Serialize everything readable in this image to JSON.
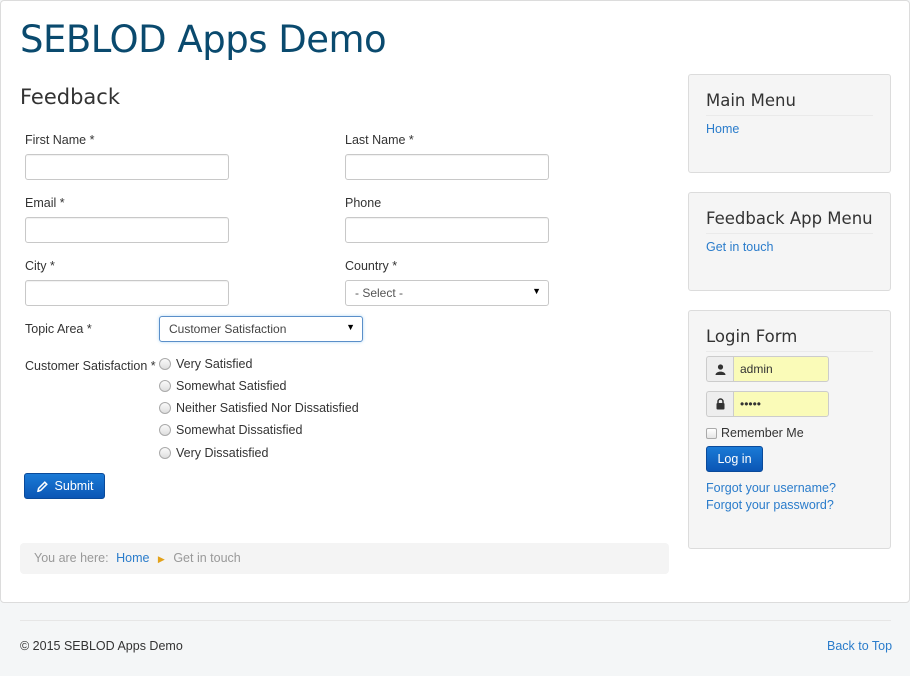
{
  "site": {
    "title": "SEBLOD Apps Demo"
  },
  "page": {
    "title": "Feedback"
  },
  "form": {
    "first_name_label": "First Name *",
    "last_name_label": "Last Name *",
    "email_label": "Email *",
    "phone_label": "Phone",
    "city_label": "City *",
    "country_label": "Country *",
    "country_value": "- Select -",
    "topic_label": "Topic Area *",
    "topic_value": "Customer Satisfaction",
    "satisfaction_label": "Customer Satisfaction *",
    "satisfaction_options": [
      "Very Satisfied",
      "Somewhat Satisfied",
      "Neither Satisfied Nor Dissatisfied",
      "Somewhat Dissatisfied",
      "Very Dissatisfied"
    ],
    "submit_label": "Submit"
  },
  "breadcrumb": {
    "prefix": "You are here:",
    "home": "Home",
    "current": "Get in touch"
  },
  "sidebar": {
    "main_menu": {
      "title": "Main Menu",
      "items": [
        "Home"
      ]
    },
    "feedback_menu": {
      "title": "Feedback App Menu",
      "items": [
        "Get in touch"
      ]
    },
    "login": {
      "title": "Login Form",
      "username": "admin",
      "password_mask": "•••••",
      "remember_label": "Remember Me",
      "login_label": "Log in",
      "forgot_username": "Forgot your username?",
      "forgot_password": "Forgot your password?"
    }
  },
  "footer": {
    "copyright": "© 2015 SEBLOD Apps Demo",
    "back_to_top": "Back to Top"
  },
  "colors": {
    "title": "#0a4a6e",
    "link": "#2a7ccb",
    "button": "#0b56b5",
    "autofill": "#fafbb8"
  }
}
